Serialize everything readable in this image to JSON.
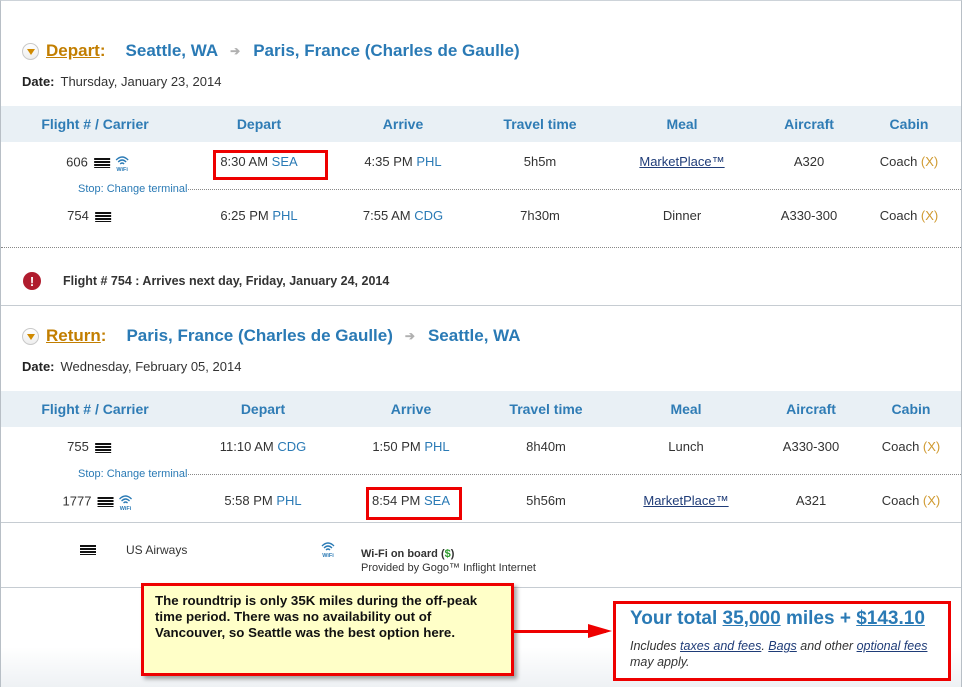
{
  "depart": {
    "label": "Depart",
    "colon": ":",
    "from": "Seattle, WA",
    "to": "Paris, France (Charles de Gaulle)",
    "date_label": "Date:",
    "date": "Thursday, January 23, 2014",
    "flights": [
      {
        "number": "606",
        "wifi": true,
        "dep_time": "8:30 AM",
        "dep_apt": "SEA",
        "arr_time": "4:35 PM",
        "arr_apt": "PHL",
        "travel": "5h5m",
        "meal": "MarketPlace™",
        "meal_link": true,
        "aircraft": "A320",
        "cabin": "Coach",
        "cabin_code": "(X)"
      },
      {
        "number": "754",
        "wifi": false,
        "dep_time": "6:25 PM",
        "dep_apt": "PHL",
        "arr_time": "7:55 AM",
        "arr_apt": "CDG",
        "travel": "7h30m",
        "meal": "Dinner",
        "meal_link": false,
        "aircraft": "A330-300",
        "cabin": "Coach",
        "cabin_code": "(X)"
      }
    ],
    "stop_text": "Stop: Change terminal"
  },
  "columns": [
    "Flight # / Carrier",
    "Depart",
    "Arrive",
    "Travel time",
    "Meal",
    "Aircraft",
    "Cabin"
  ],
  "alert": "Flight # 754 : Arrives next day, Friday, January 24, 2014",
  "return": {
    "label": "Return",
    "colon": ":",
    "from": "Paris, France (Charles de Gaulle)",
    "to": "Seattle, WA",
    "date_label": "Date:",
    "date": "Wednesday, February 05, 2014",
    "flights": [
      {
        "number": "755",
        "wifi": false,
        "dep_time": "11:10 AM",
        "dep_apt": "CDG",
        "arr_time": "1:50 PM",
        "arr_apt": "PHL",
        "travel": "8h40m",
        "meal": "Lunch",
        "meal_link": false,
        "aircraft": "A330-300",
        "cabin": "Coach",
        "cabin_code": "(X)"
      },
      {
        "number": "1777",
        "wifi": true,
        "dep_time": "5:58 PM",
        "dep_apt": "PHL",
        "arr_time": "8:54 PM",
        "arr_apt": "SEA",
        "travel": "5h56m",
        "meal": "MarketPlace™",
        "meal_link": true,
        "aircraft": "A321",
        "cabin": "Coach",
        "cabin_code": "(X)"
      }
    ],
    "stop_text": "Stop: Change terminal"
  },
  "legend": {
    "carrier": "US Airways",
    "wifi_title": "Wi-Fi on board (",
    "wifi_dollar": "$",
    "wifi_close": ")",
    "wifi_provider": "Provided by Gogo™ Inflight Internet"
  },
  "note": "The roundtrip is only 35K miles during the off-peak time period. There was no availability out of Vancouver, so Seattle was the best option here.",
  "total": {
    "prefix": "Your total ",
    "miles": "35,000",
    "miles_suffix": " miles + ",
    "price": "$143.10",
    "incl_1": "Includes ",
    "taxes_link": "taxes and fees",
    "incl_2": ". ",
    "bags_link": "Bags",
    "incl_3": " and other ",
    "optional_link": "optional fees",
    "incl_4": " may apply."
  },
  "colors": {
    "accent_blue": "#2a7ab5",
    "segment_orange": "#c27e00",
    "highlight_red": "#ee0000",
    "note_yellow": "#ffffc8"
  }
}
